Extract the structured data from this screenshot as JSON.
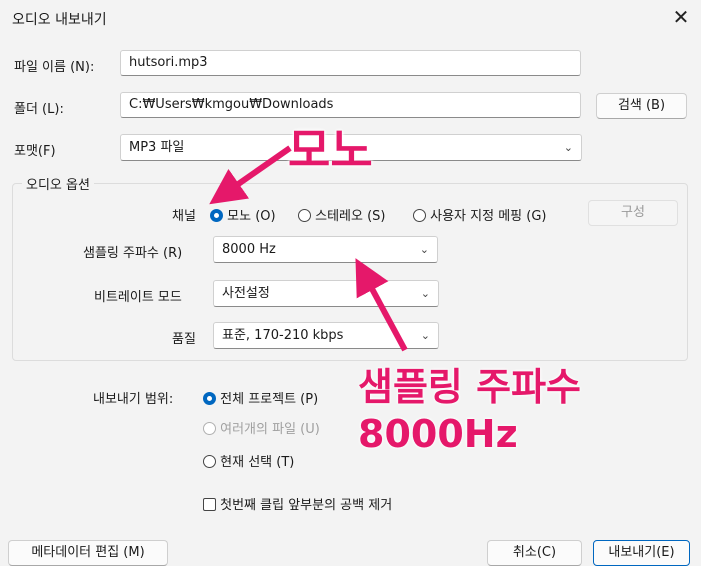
{
  "window": {
    "title": "오디오 내보내기",
    "close_glyph": "✕"
  },
  "file_name": {
    "label": "파일 이름 (N):",
    "value": "hutsori.mp3"
  },
  "folder": {
    "label": "폴더 (L):",
    "value": "C:₩Users₩kmgou₩Downloads",
    "browse_label": "검색 (B)"
  },
  "format": {
    "label": "포맷(F)",
    "value": "MP3 파일"
  },
  "audio_options": {
    "title": "오디오 옵션",
    "channel_label": "채널",
    "channels": [
      {
        "label": "모노 (O)",
        "selected": true
      },
      {
        "label": "스테레오 (S)",
        "selected": false
      },
      {
        "label": "사용자 지정 메핑 (G)",
        "selected": false
      }
    ],
    "configure_label": "구성",
    "sample_rate": {
      "label": "샘플링 주파수 (R)",
      "value": "8000 Hz"
    },
    "bitrate_mode": {
      "label": "비트레이트 모드",
      "value": "사전설정"
    },
    "quality": {
      "label": "품질",
      "value": "표준, 170-210 kbps"
    }
  },
  "export_range": {
    "label": "내보내기 범위:",
    "options": [
      {
        "label": "전체 프로젝트 (P)",
        "selected": true,
        "enabled": true
      },
      {
        "label": "여러개의 파일 (U)",
        "selected": false,
        "enabled": false
      },
      {
        "label": "현재 선택 (T)",
        "selected": false,
        "enabled": true
      }
    ]
  },
  "trim_silence": {
    "label": "첫번째 클립 앞부분의 공백 제거",
    "checked": false
  },
  "footer": {
    "metadata_label": "메타데이터 편집 (M)",
    "cancel_label": "취소(C)",
    "export_label": "내보내기(E)"
  },
  "annotations": {
    "mono": "모노",
    "rate_line1": "샘플링 주파수",
    "rate_line2": "8000Hz",
    "color": "#e5186a"
  },
  "colors": {
    "accent": "#0067c0",
    "background": "#f3f3f3"
  }
}
